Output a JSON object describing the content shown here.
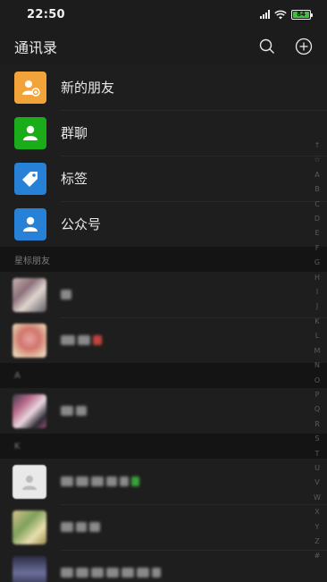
{
  "status": {
    "time": "22:50",
    "battery": "84"
  },
  "nav": {
    "title": "通讯录"
  },
  "top_items": [
    {
      "label": "新的朋友",
      "color": "#f2a43a",
      "icon": "add-friend-icon"
    },
    {
      "label": "群聊",
      "color": "#1aad19",
      "icon": "group-chat-icon"
    },
    {
      "label": "标签",
      "color": "#2782d7",
      "icon": "tag-icon"
    },
    {
      "label": "公众号",
      "color": "#2782d7",
      "icon": "official-account-icon"
    }
  ],
  "sections": {
    "starred": "星标朋友",
    "a": "A",
    "k": "K"
  },
  "index_letters": [
    "↑",
    "☆",
    "A",
    "B",
    "C",
    "D",
    "E",
    "F",
    "G",
    "H",
    "I",
    "J",
    "K",
    "L",
    "M",
    "N",
    "O",
    "P",
    "Q",
    "R",
    "S",
    "T",
    "U",
    "V",
    "W",
    "X",
    "Y",
    "Z",
    "#"
  ]
}
